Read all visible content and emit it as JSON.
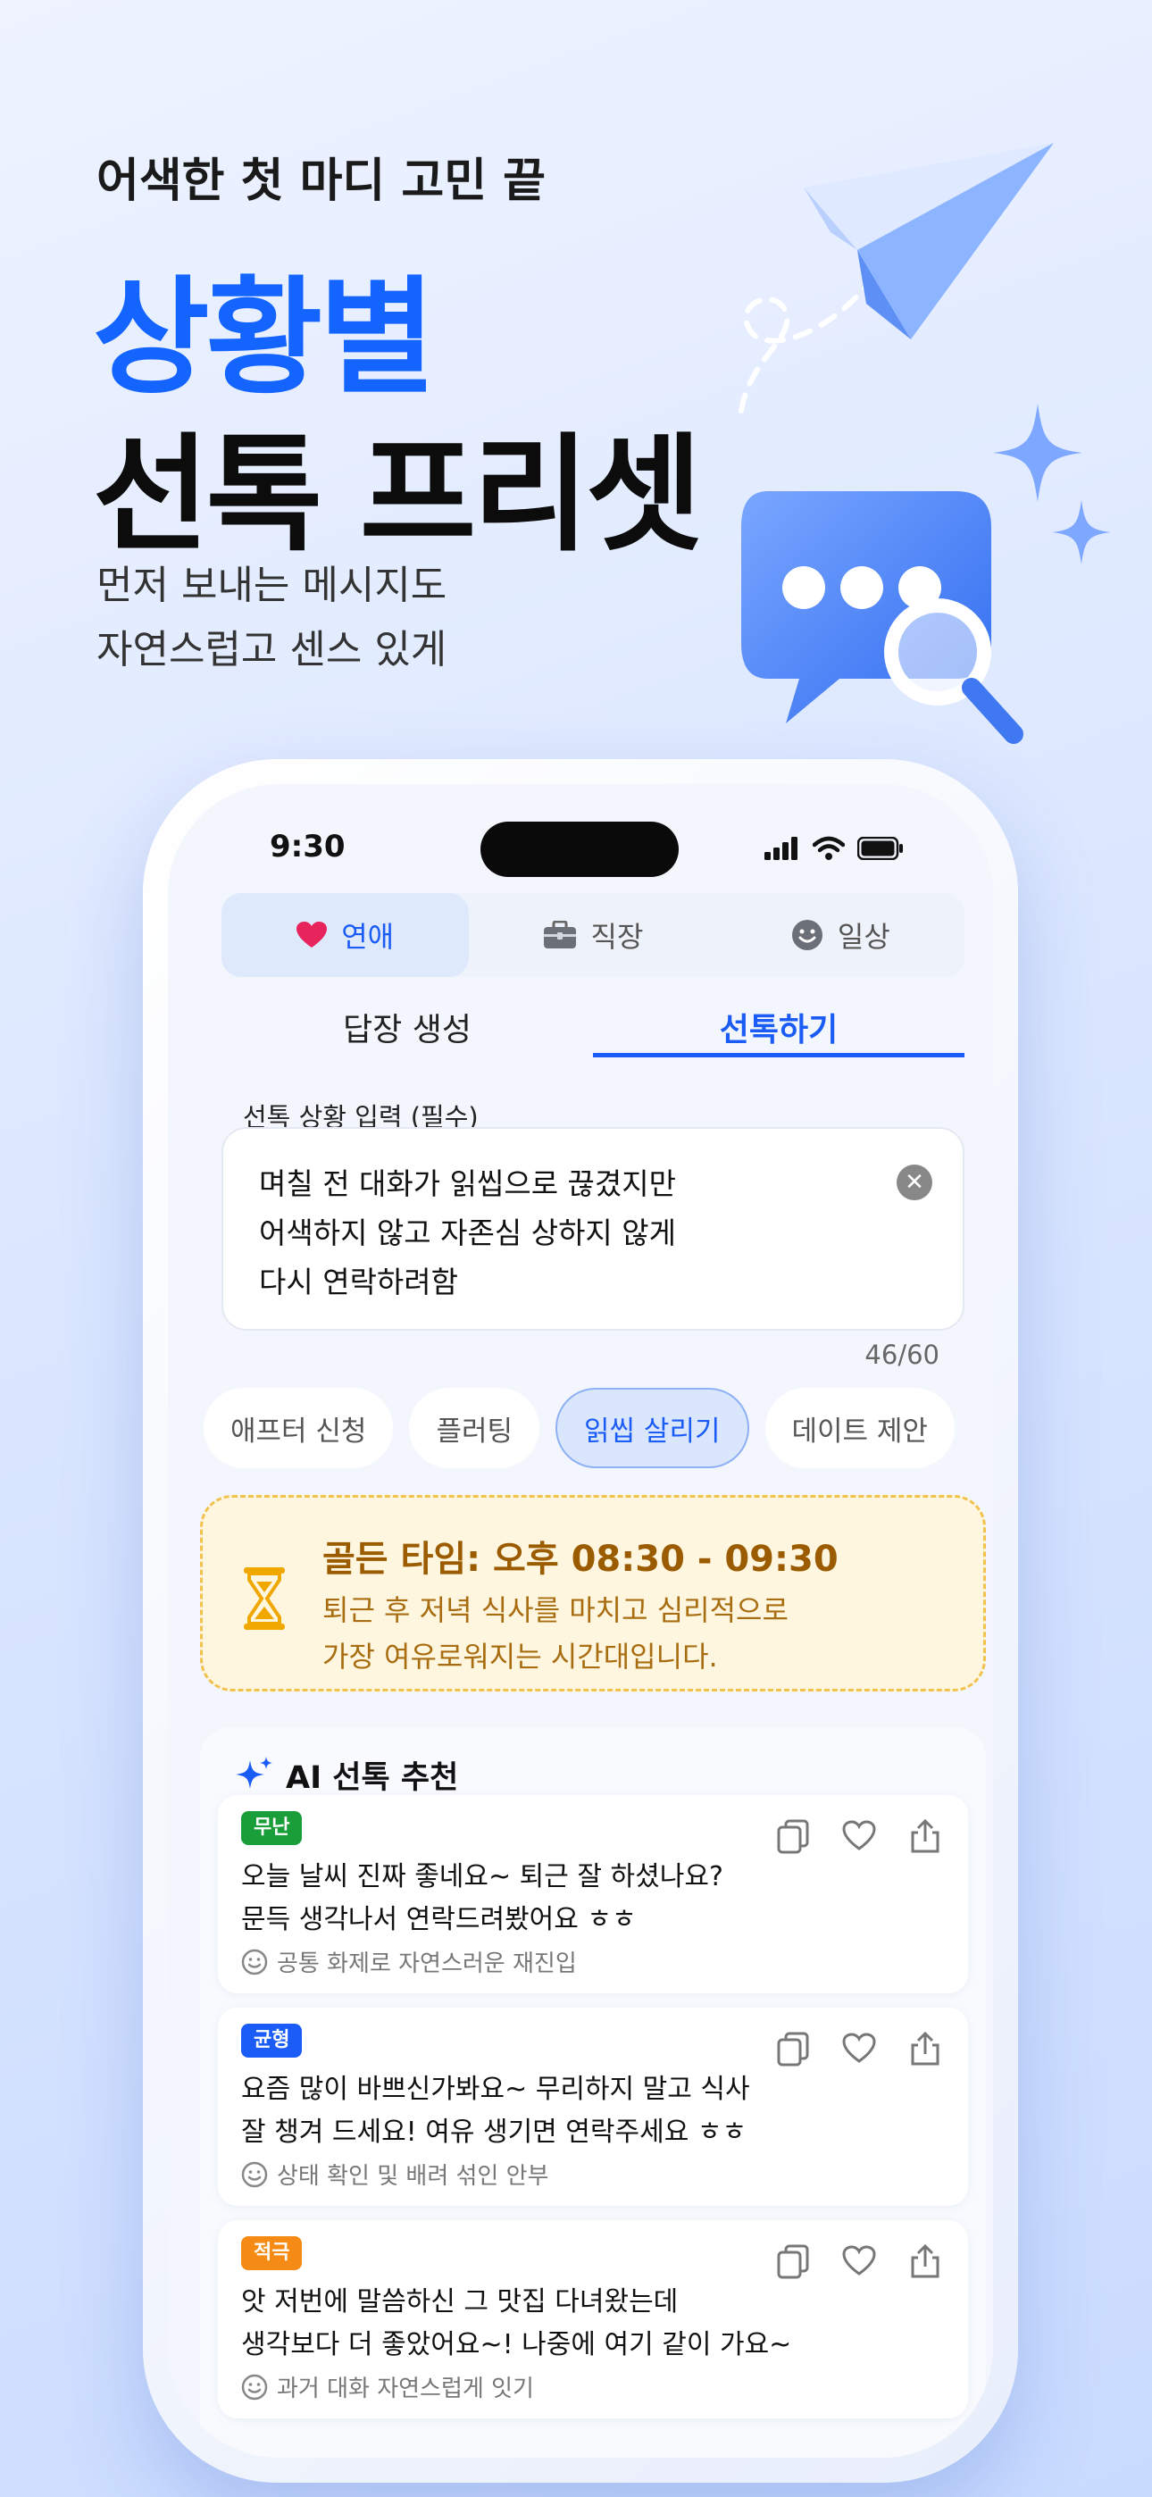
{
  "hero": {
    "subtitle": "어색한 첫 마디 고민 끝",
    "title_line1": "상황별",
    "title_line2": "선톡 프리셋",
    "desc_line1": "먼저 보내는 메시지도",
    "desc_line2": "자연스럽고 센스 있게"
  },
  "status": {
    "time": "9:30"
  },
  "category_tabs": [
    {
      "label": "연애",
      "icon": "heart-icon",
      "active": true
    },
    {
      "label": "직장",
      "icon": "briefcase-icon",
      "active": false
    },
    {
      "label": "일상",
      "icon": "smile-icon",
      "active": false
    }
  ],
  "mode_tabs": [
    {
      "label": "답장 생성",
      "active": false
    },
    {
      "label": "선톡하기",
      "active": true
    }
  ],
  "input": {
    "label": "선톡 상황 입력 (필수)",
    "line1": "며칠 전 대화가 읽씹으로 끊겼지만",
    "line2": "어색하지 않고 자존심 상하지 않게",
    "line3": "다시 연락하려함",
    "count": "46/60"
  },
  "chips": [
    {
      "label": "애프터 신청",
      "active": false
    },
    {
      "label": "플러팅",
      "active": false
    },
    {
      "label": "읽씹 살리기",
      "active": true
    },
    {
      "label": "데이트 제안",
      "active": false
    }
  ],
  "golden": {
    "title": "골든 타임: 오후 08:30 - 09:30",
    "line1": "퇴근 후 저녁 식사를 마치고 심리적으로",
    "line2": "가장 여유로워지는 시간대입니다."
  },
  "ai": {
    "title": "AI 선톡 추천",
    "cards": [
      {
        "badge": "무난",
        "badge_color": "#1a9e3a",
        "line1": "오늘 날씨 진짜 좋네요~ 퇴근 잘 하셨나요?",
        "line2": "문득 생각나서 연락드려봤어요 ㅎㅎ",
        "hint": "공통 화제로 자연스러운 재진입"
      },
      {
        "badge": "균형",
        "badge_color": "#1a5cf5",
        "line1": "요즘 많이 바쁘신가봐요~ 무리하지 말고 식사",
        "line2": "잘 챙겨 드세요! 여유 생기면 연락주세요 ㅎㅎ",
        "hint": "상태 확인 및 배려 섞인 안부"
      },
      {
        "badge": "적극",
        "badge_color": "#f58a14",
        "line1": "앗 저번에 말씀하신 그 맛집 다녀왔는데",
        "line2": "생각보다 더 좋았어요~! 나중에 여기 같이 가요~",
        "hint": "과거 대화 자연스럽게 잇기"
      }
    ]
  },
  "colors": {
    "accent": "#1a5cf5",
    "hero_blue": "#1464ff",
    "golden_bg": "#fff6df"
  }
}
